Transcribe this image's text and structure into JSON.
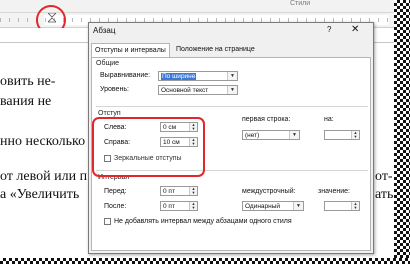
{
  "ribbon": {
    "styles_label": "Стили"
  },
  "document": {
    "lines": [
      {
        "text": "овить  не-"
      },
      {
        "text": "вания  не"
      },
      {
        "text": "нно несколько"
      },
      {
        "text": "от левой или п"
      },
      {
        "text": "а «Увеличить"
      }
    ],
    "right_fragments": [
      "от-",
      "ать"
    ]
  },
  "dialog": {
    "title": "Абзац",
    "help_label": "?",
    "close_label": "✕",
    "tabs": [
      "Отступы и интервалы",
      "Положение на странице"
    ],
    "general": {
      "section": "Общие",
      "alignment_label": "Выравнивание:",
      "alignment_value": "По ширине",
      "level_label": "Уровень:",
      "level_value": "Основной текст"
    },
    "indent": {
      "section": "Отступ",
      "left_label": "Слева:",
      "left_value": "0 см",
      "right_label": "Справа:",
      "right_value": "10 см",
      "first_line_label": "первая строка:",
      "first_line_value": "(нет)",
      "by_label": "на:",
      "mirror_label": "Зеркальные отступы"
    },
    "spacing": {
      "section": "Интервал",
      "before_label": "Перед:",
      "before_value": "0 пт",
      "after_label": "После:",
      "after_value": "0 пт",
      "line_label": "междустрочный:",
      "line_value": "Одинарный",
      "value_label": "значение:",
      "no_add_label": "Не добавлять интервал между абзацами одного стиля"
    }
  },
  "colors": {
    "highlight": "#e3262b",
    "selection": "#3a79d8"
  }
}
